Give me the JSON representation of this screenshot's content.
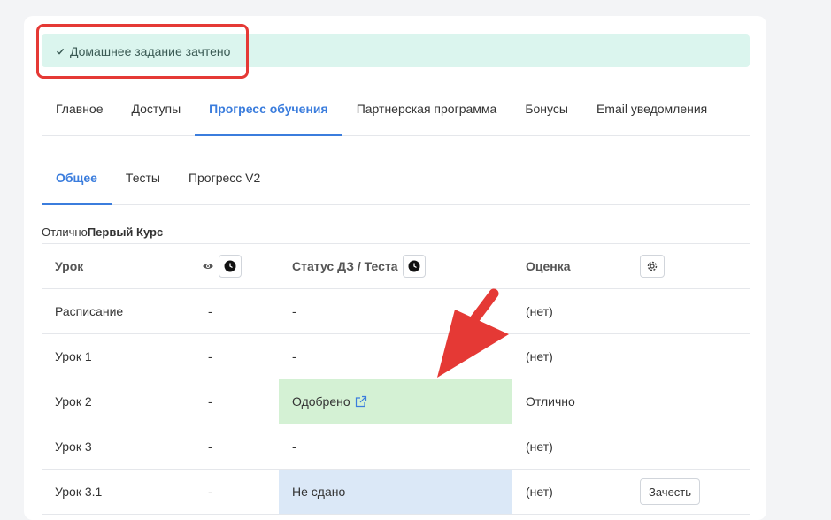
{
  "alert": {
    "text": "Домашнее задание зачтено",
    "icon": "check-icon",
    "color": "#dbf5ee"
  },
  "tabs": [
    {
      "label": "Главное",
      "active": false
    },
    {
      "label": "Доступы",
      "active": false
    },
    {
      "label": "Прогресс обучения",
      "active": true
    },
    {
      "label": "Партнерская программа",
      "active": false
    },
    {
      "label": "Бонусы",
      "active": false
    },
    {
      "label": "Email уведомления",
      "active": false
    }
  ],
  "subtabs": [
    {
      "label": "Общее",
      "active": true
    },
    {
      "label": "Тесты",
      "active": false
    },
    {
      "label": "Прогресс V2",
      "active": false
    }
  ],
  "course": {
    "prefix": "Отлично",
    "name": "Первый Курс"
  },
  "table": {
    "headers": {
      "lesson": "Урок",
      "status": "Статус ДЗ / Теста",
      "grade": "Оценка"
    },
    "rows": [
      {
        "lesson": "Расписание",
        "seen": "-",
        "status": "-",
        "grade": "(нет)"
      },
      {
        "lesson": "Урок 1",
        "seen": "-",
        "status": "-",
        "grade": "(нет)"
      },
      {
        "lesson": "Урок 2",
        "seen": "-",
        "status": "Одобрено",
        "grade": "Отлично"
      },
      {
        "lesson": "Урок 3",
        "seen": "-",
        "status": "-",
        "grade": "(нет)"
      },
      {
        "lesson": "Урок 3.1",
        "seen": "-",
        "status": "Не сдано",
        "grade": "(нет)",
        "action": "Зачесть"
      }
    ]
  },
  "colors": {
    "accent": "#3b7ddd",
    "approved": "#d4f1d4",
    "not_submitted": "#dbe8f7",
    "annotation": "#e53935"
  }
}
